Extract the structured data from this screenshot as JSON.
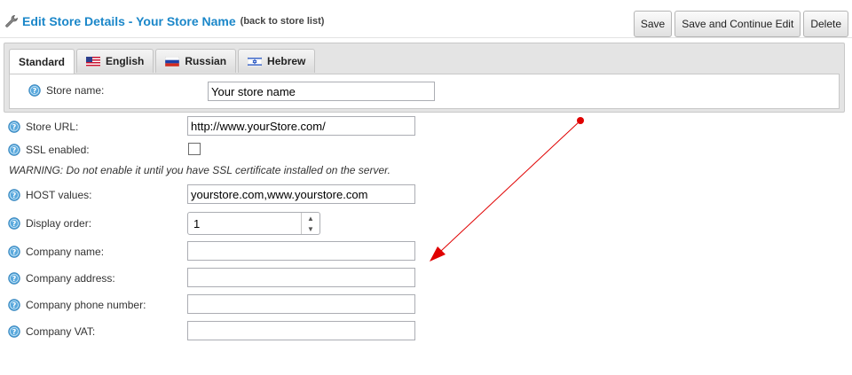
{
  "header": {
    "title": "Edit Store Details - Your Store Name",
    "back_link": "(back to store list)",
    "buttons": {
      "save": "Save",
      "save_continue": "Save and Continue Edit",
      "delete": "Delete"
    }
  },
  "tabs": [
    {
      "label": "Standard",
      "active": true
    },
    {
      "label": "English",
      "flag": "us-flag-icon"
    },
    {
      "label": "Russian",
      "flag": "ru-flag-icon"
    },
    {
      "label": "Hebrew",
      "flag": "il-flag-icon"
    }
  ],
  "localized": {
    "store_name_label": "Store name:",
    "store_name_value": "Your store name"
  },
  "fields": {
    "store_url": {
      "label": "Store URL:",
      "value": "http://www.yourStore.com/"
    },
    "ssl": {
      "label": "SSL enabled:",
      "checked": false
    },
    "warning": "WARNING: Do not enable it until you have SSL certificate installed on the server.",
    "host": {
      "label": "HOST values:",
      "value": "yourstore.com,www.yourstore.com"
    },
    "display_order": {
      "label": "Display order:",
      "value": "1"
    },
    "company_name": {
      "label": "Company name:",
      "value": ""
    },
    "company_address": {
      "label": "Company address:",
      "value": ""
    },
    "company_phone": {
      "label": "Company phone number:",
      "value": ""
    },
    "company_vat": {
      "label": "Company VAT:",
      "value": ""
    }
  },
  "colors": {
    "title": "#1b87c9",
    "annotation_arrow": "#e00000"
  }
}
